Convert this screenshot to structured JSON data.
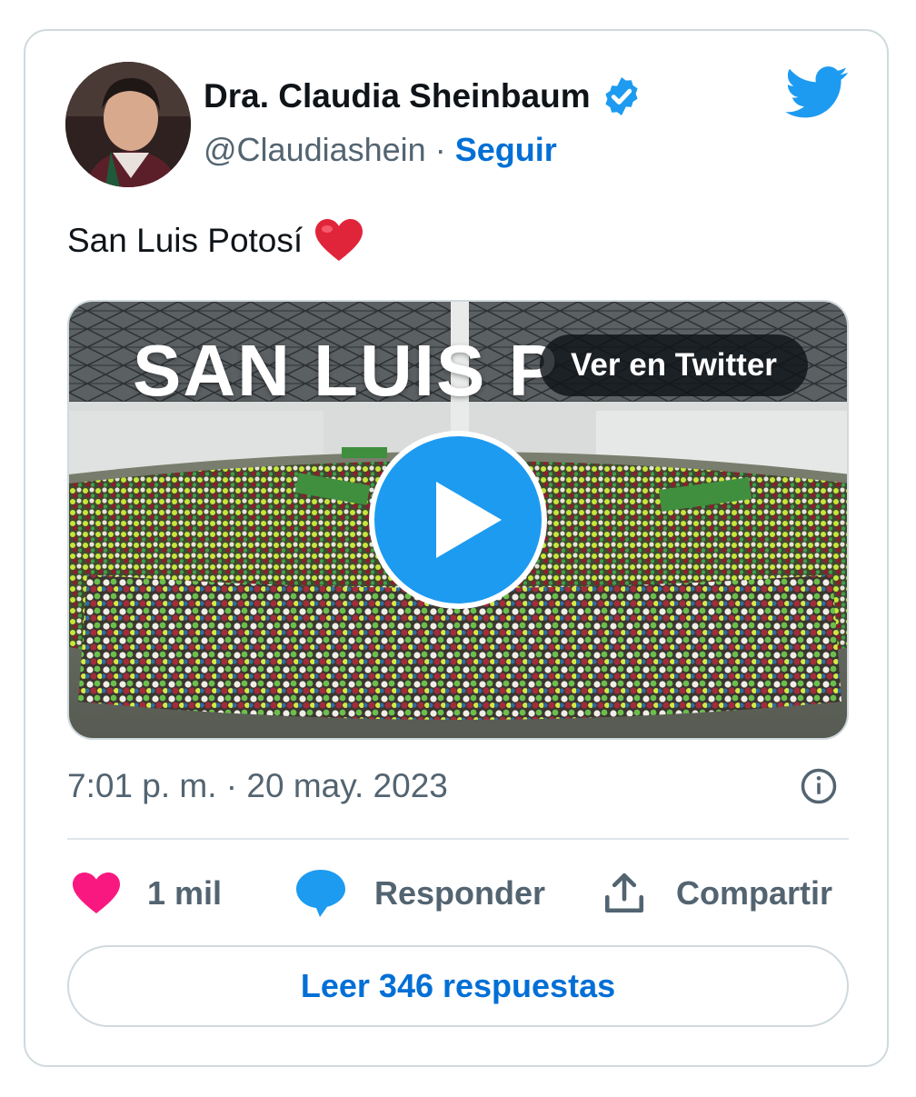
{
  "author": {
    "name": "Dra. Claudia Sheinbaum",
    "handle": "@Claudiashein",
    "separator": "·",
    "follow_label": "Seguir",
    "verified": true
  },
  "tweet": {
    "text": "San Luis Potosí",
    "emoji": "red-heart"
  },
  "media": {
    "overlay_text": "SAN LUIS P",
    "watch_label": "Ver en Twitter",
    "type": "video"
  },
  "timestamp": "7:01 p. m. · 20 may. 2023",
  "actions": {
    "likes": "1 mil",
    "reply_label": "Responder",
    "share_label": "Compartir"
  },
  "read_replies_label": "Leer 346 respuestas",
  "colors": {
    "link_blue": "#006fd6",
    "twitter_blue": "#1d9bf0",
    "like_pink": "#f91880",
    "text_primary": "#0f1419",
    "text_secondary": "#536471",
    "border": "#cfd9de"
  }
}
